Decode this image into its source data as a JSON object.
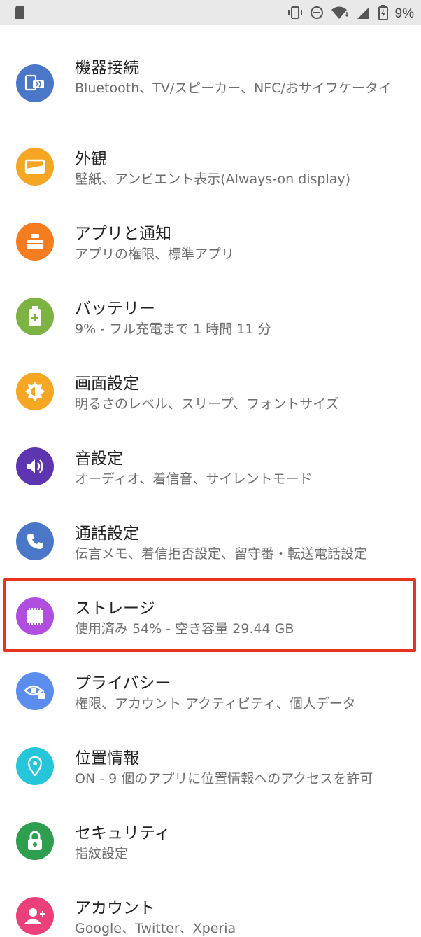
{
  "status_bar": {
    "battery_percent": "9%",
    "icons": [
      "sd-card-icon",
      "vibrate-icon",
      "do-not-disturb-icon",
      "wifi-icon",
      "signal-icon",
      "battery-charging-icon"
    ]
  },
  "settings": {
    "items": [
      {
        "title": "機器接続",
        "subtitle": "Bluetooth、TV/スピーカー、NFC/おサイフケータイ",
        "icon": "device-connection-icon",
        "color": "#4a77c8"
      },
      {
        "title": "外観",
        "subtitle": "壁紙、アンビエント表示(Always-on display)",
        "icon": "appearance-icon",
        "color": "#f5a623"
      },
      {
        "title": "アプリと通知",
        "subtitle": "アプリの権限、標準アプリ",
        "icon": "apps-icon",
        "color": "#f57c1f"
      },
      {
        "title": "バッテリー",
        "subtitle": "9% - フル充電まで 1 時間 11 分",
        "icon": "battery-icon",
        "color": "#7cb342"
      },
      {
        "title": "画面設定",
        "subtitle": "明るさのレベル、スリープ、フォントサイズ",
        "icon": "brightness-icon",
        "color": "#f5a623"
      },
      {
        "title": "音設定",
        "subtitle": "オーディオ、着信音、サイレントモード",
        "icon": "volume-icon",
        "color": "#5e35b1"
      },
      {
        "title": "通話設定",
        "subtitle": "伝言メモ、着信拒否設定、留守番・転送電話設定",
        "icon": "phone-icon",
        "color": "#4a77c8"
      },
      {
        "title": "ストレージ",
        "subtitle": "使用済み 54% - 空き容量 29.44 GB",
        "icon": "storage-icon",
        "color": "#b14ee0"
      },
      {
        "title": "プライバシー",
        "subtitle": "権限、アカウント アクティビティ、個人データ",
        "icon": "privacy-eye-icon",
        "color": "#5b8def"
      },
      {
        "title": "位置情報",
        "subtitle": "ON - 9 個のアプリに位置情報へのアクセスを許可",
        "icon": "location-icon",
        "color": "#26c6da"
      },
      {
        "title": "セキュリティ",
        "subtitle": "指紋設定",
        "icon": "lock-icon",
        "color": "#2e9e4f"
      },
      {
        "title": "アカウント",
        "subtitle": "Google、Twitter、Xperia",
        "icon": "account-icon",
        "color": "#ec407a"
      }
    ]
  },
  "highlight": {
    "color": "#e8341f",
    "target": "ストレージ"
  }
}
